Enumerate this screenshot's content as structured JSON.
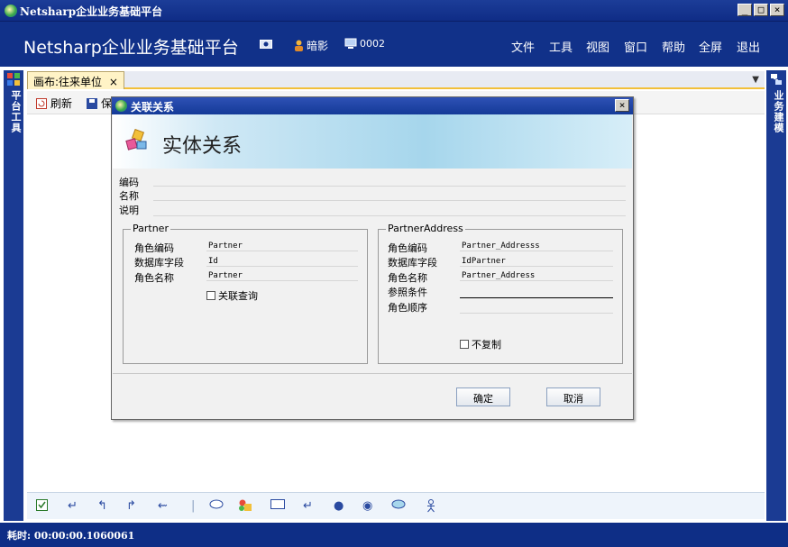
{
  "window": {
    "title": "Netsharp企业业务基础平台",
    "btn_min": "_",
    "btn_max": "□",
    "btn_close": "×"
  },
  "header": {
    "app_title": "Netsharp企业业务基础平台",
    "user": "暗影",
    "code": "0002",
    "menu": [
      "文件",
      "工具",
      "视图",
      "窗口",
      "帮助",
      "全屏",
      "退出"
    ]
  },
  "side": {
    "left_label": "平台工具",
    "right_label": "业务建模"
  },
  "tab": {
    "label": "画布:往来单位",
    "close": "×"
  },
  "toolbar": {
    "refresh": "刷新",
    "save_partial": "保"
  },
  "dialog": {
    "title": "关联关系",
    "banner_title": "实体关系",
    "close": "×",
    "meta": {
      "code_label": "编码",
      "name_label": "名称",
      "desc_label": "说明"
    },
    "left": {
      "legend": "Partner",
      "role_code_label": "角色编码",
      "role_code": "Partner",
      "db_field_label": "数据库字段",
      "db_field": "Id",
      "role_name_label": "角色名称",
      "role_name": "Partner",
      "check_label": "关联查询"
    },
    "right": {
      "legend": "PartnerAddress",
      "role_code_label": "角色编码",
      "role_code": "Partner_Addresss",
      "db_field_label": "数据库字段",
      "db_field": "IdPartner",
      "role_name_label": "角色名称",
      "role_name": "Partner_Address",
      "ref_cond_label": "参照条件",
      "role_order_label": "角色顺序",
      "check_label": "不复制"
    },
    "ok": "确定",
    "cancel": "取消"
  },
  "status": {
    "text": "耗时: 00:00:00.1060061"
  },
  "colors": {
    "header": "#113189",
    "status": "#0e2e86",
    "tab_bg": "#fff3c6",
    "banner": "#a6d6ec"
  }
}
